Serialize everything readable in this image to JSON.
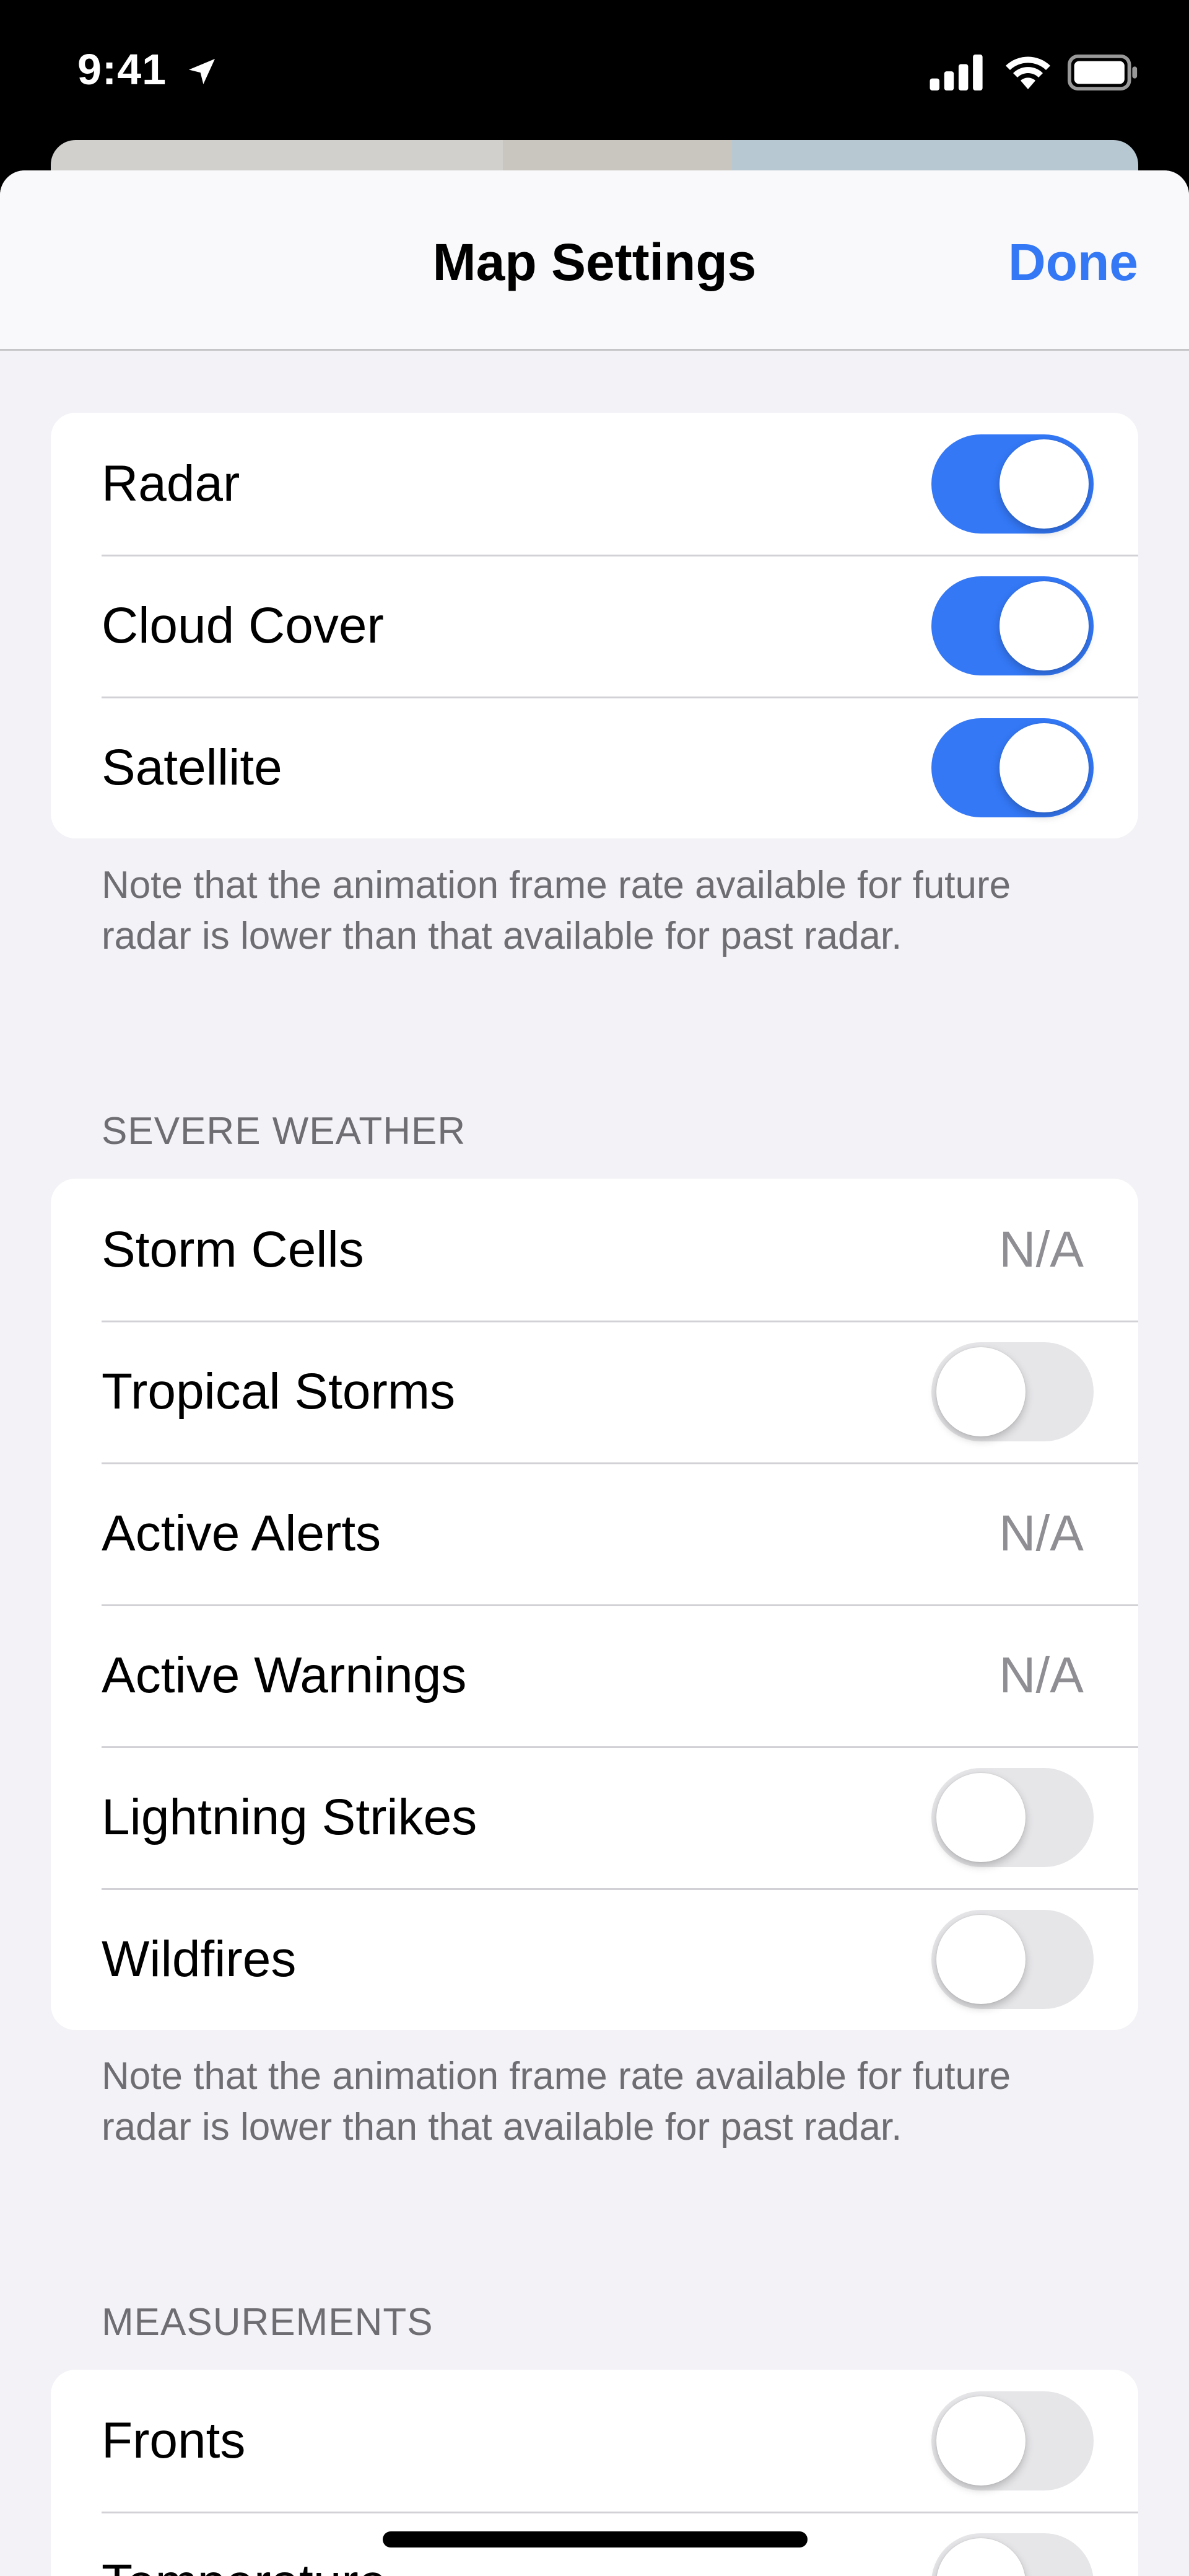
{
  "status_bar": {
    "time": "9:41"
  },
  "nav": {
    "title": "Map Settings",
    "done_label": "Done"
  },
  "layers": {
    "rows": [
      {
        "label": "Radar",
        "toggle": "on"
      },
      {
        "label": "Cloud Cover",
        "toggle": "on"
      },
      {
        "label": "Satellite",
        "toggle": "on"
      }
    ],
    "note": "Note that the animation frame rate available for future radar is lower than that available for past radar."
  },
  "severe_weather": {
    "header": "SEVERE WEATHER",
    "rows": [
      {
        "label": "Storm Cells",
        "value": "N/A"
      },
      {
        "label": "Tropical Storms",
        "toggle": "off"
      },
      {
        "label": "Active Alerts",
        "value": "N/A"
      },
      {
        "label": "Active Warnings",
        "value": "N/A"
      },
      {
        "label": "Lightning Strikes",
        "toggle": "off"
      },
      {
        "label": "Wildfires",
        "toggle": "off"
      }
    ],
    "note": "Note that the animation frame rate available for future radar is lower than that available for past radar."
  },
  "measurements": {
    "header": "MEASUREMENTS",
    "rows": [
      {
        "label": "Fronts",
        "toggle": "off"
      },
      {
        "label": "Temperature",
        "toggle": "off"
      }
    ]
  },
  "colors": {
    "accent": "#3478f6",
    "toggle_off": "#e6e6e9",
    "background": "#f2f2f7",
    "secondary_text": "#8e8e93"
  },
  "icons": [
    "location-arrow-icon",
    "cellular-signal-icon",
    "wifi-icon",
    "battery-icon"
  ]
}
